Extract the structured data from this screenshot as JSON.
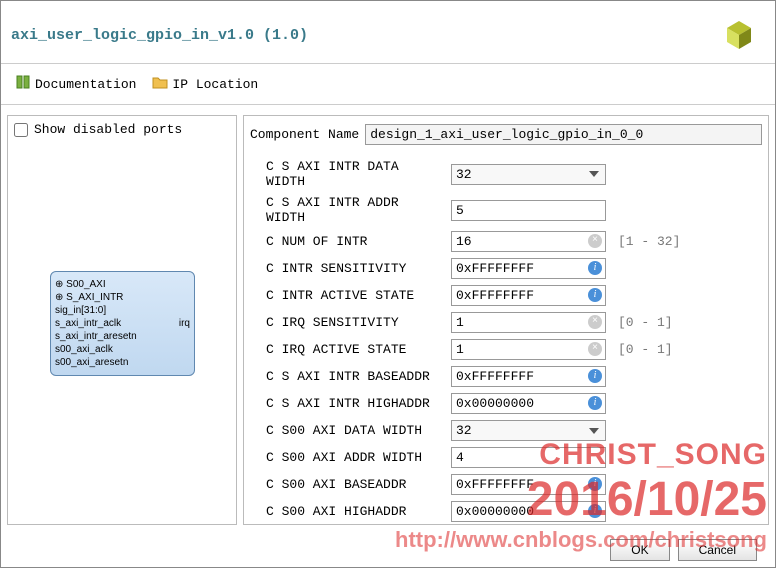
{
  "title": "axi_user_logic_gpio_in_v1.0 (1.0)",
  "tabs": {
    "doc": "Documentation",
    "iploc": "IP Location"
  },
  "left": {
    "show_disabled": "Show disabled ports",
    "ports_in": [
      "S00_AXI",
      "S_AXI_INTR",
      "sig_in[31:0]",
      "s_axi_intr_aclk",
      "s_axi_intr_aresetn",
      "s00_axi_aclk",
      "s00_axi_aresetn"
    ],
    "ports_out": [
      "irq"
    ]
  },
  "comp_name_label": "Component Name",
  "comp_name": "design_1_axi_user_logic_gpio_in_0_0",
  "params": [
    {
      "label": "C S AXI INTR DATA WIDTH",
      "value": "32",
      "type": "select"
    },
    {
      "label": "C S AXI INTR ADDR WIDTH",
      "value": "5",
      "type": "text"
    },
    {
      "label": "C NUM OF INTR",
      "value": "16",
      "type": "text",
      "hint": "[1 - 32]",
      "clear": true
    },
    {
      "label": "C INTR SENSITIVITY",
      "value": "0xFFFFFFFF",
      "type": "text",
      "info": true
    },
    {
      "label": "C INTR ACTIVE STATE",
      "value": "0xFFFFFFFF",
      "type": "text",
      "info": true
    },
    {
      "label": "C IRQ SENSITIVITY",
      "value": "1",
      "type": "text",
      "hint": "[0 - 1]",
      "clear": true
    },
    {
      "label": "C IRQ ACTIVE STATE",
      "value": "1",
      "type": "text",
      "hint": "[0 - 1]",
      "clear": true
    },
    {
      "label": "C S AXI INTR BASEADDR",
      "value": "0xFFFFFFFF",
      "type": "text",
      "info": true
    },
    {
      "label": "C S AXI INTR HIGHADDR",
      "value": "0x00000000",
      "type": "text",
      "info": true
    },
    {
      "label": "C S00 AXI DATA WIDTH",
      "value": "32",
      "type": "select"
    },
    {
      "label": "C S00 AXI ADDR WIDTH",
      "value": "4",
      "type": "text"
    },
    {
      "label": "C S00 AXI BASEADDR",
      "value": "0xFFFFFFFF",
      "type": "text",
      "info": true
    },
    {
      "label": "C S00 AXI HIGHADDR",
      "value": "0x00000000",
      "type": "text",
      "info": true
    }
  ],
  "buttons": {
    "ok": "OK",
    "cancel": "Cancel"
  },
  "watermark": {
    "name": "CHRIST_SONG",
    "date": "2016/10/25",
    "url": "http://www.cnblogs.com/christsong"
  }
}
